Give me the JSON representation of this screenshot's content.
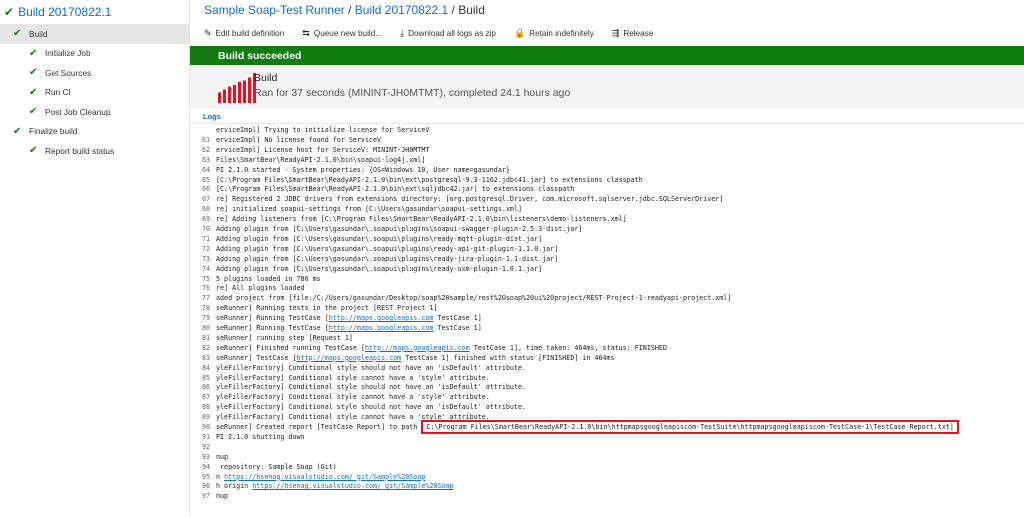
{
  "sidebar": {
    "build_title": "Build 20170822.1",
    "items": [
      {
        "label": "Build",
        "level": 0,
        "selected": true
      },
      {
        "label": "Initialize Job",
        "level": 1
      },
      {
        "label": "Get Sources",
        "level": 1
      },
      {
        "label": "Run CI",
        "level": 1
      },
      {
        "label": "Post Job Cleanup",
        "level": 1
      },
      {
        "label": "Finalize build",
        "level": 0
      },
      {
        "label": "Report build status",
        "level": 1
      }
    ]
  },
  "breadcrumb": {
    "runner": "Sample Soap-Test Runner",
    "sep1": " / ",
    "build": "Build 20170822.1",
    "sep2": " / ",
    "current": "Build"
  },
  "toolbar": {
    "items": [
      {
        "label": "Edit build definition",
        "icon": "pencil-icon",
        "glyph": "✎"
      },
      {
        "label": "Queue new build...",
        "icon": "queue-icon",
        "glyph": "⇆"
      },
      {
        "label": "Download all logs as zip",
        "icon": "download-icon",
        "glyph": "⤓"
      },
      {
        "label": "Retain indefinitely",
        "icon": "lock-icon",
        "glyph": "🔒"
      },
      {
        "label": "Release",
        "icon": "release-icon",
        "glyph": "⇶"
      }
    ]
  },
  "banner": {
    "text": "Build succeeded",
    "color": "#107c10"
  },
  "summary": {
    "name": "Build",
    "detail": "Ran for 37 seconds (MININT-JH0MTMT), completed 24.1 hours ago",
    "bar_levels": [
      0.35,
      0.45,
      0.55,
      0.6,
      0.7,
      0.75,
      0.85,
      1.0
    ],
    "bar_color": "#e81123"
  },
  "logs": {
    "label": "Logs",
    "lines": [
      {
        "n": "",
        "text": "erviceImpl] Trying to initialize license for ServiceV"
      },
      {
        "n": "61",
        "text": "erviceImpl] No license found for ServiceV"
      },
      {
        "n": "62",
        "text": "erviceImpl] License host for ServiceV: MININT-JH0MTMT"
      },
      {
        "n": "63",
        "text": "Files\\SmartBear\\ReadyAPI-2.1.0\\bin\\soapui-log4j.xml]"
      },
      {
        "n": "64",
        "text": "PI 2.1.0 started - System properties: {OS=Windows 10, User name=gasundar}"
      },
      {
        "n": "65",
        "text": "[C:\\Program Files\\SmartBear\\ReadyAPI-2.1.0\\bin\\ext\\postgresql-9.3-1102.jdbc41.jar] to extensions classpath"
      },
      {
        "n": "66",
        "text": "[C:\\Program Files\\SmartBear\\ReadyAPI-2.1.0\\bin\\ext\\sqljdbc42.jar] to extensions classpath"
      },
      {
        "n": "67",
        "text": "re] Registered 2 JDBC drivers from extensions directory: [org.postgresql.Driver, com.microsoft.sqlserver.jdbc.SQLServerDriver]"
      },
      {
        "n": "68",
        "text": "re] initialized soapui-settings from [C:\\Users\\gasundar\\soapui-settings.xml]"
      },
      {
        "n": "69",
        "text": "re] Adding listeners from [C:\\Program Files\\SmartBear\\ReadyAPI-2.1.0\\bin\\listeners\\demo-listeners.xml]"
      },
      {
        "n": "70",
        "text": "Adding plugin from [C:\\Users\\gasundar\\.soapui\\plugins\\soapui-swagger-plugin-2.5.3-dist.jar]"
      },
      {
        "n": "71",
        "text": "Adding plugin from [C:\\Users\\gasundar\\.soapui\\plugins\\ready-mqtt-plugin-dist.jar]"
      },
      {
        "n": "72",
        "text": "Adding plugin from [C:\\Users\\gasundar\\.soapui\\plugins\\ready-api-git-plugin-1.1.0.jar]"
      },
      {
        "n": "73",
        "text": "Adding plugin from [C:\\Users\\gasundar\\.soapui\\plugins\\ready-jira-plugin-1.1-dist.jar]"
      },
      {
        "n": "74",
        "text": "Adding plugin from [C:\\Users\\gasundar\\.soapui\\plugins\\ready-uxm-plugin-1.0.1.jar]"
      },
      {
        "n": "75",
        "text": "5 plugins loaded in 786 ms"
      },
      {
        "n": "76",
        "text": "re] All plugins loaded"
      },
      {
        "n": "77",
        "text": "aded project from [file:/C:/Users/gasundar/Desktop/soap%20sample/rest%20soap%20ui%20project/REST-Project-1-readyapi-project.xml]"
      },
      {
        "n": "78",
        "text": "seRunner] Running tests in the project [REST Project 1]"
      },
      {
        "n": "79",
        "pre": "seRunner] Running TestCase [",
        "link": "http://maps.googleapis.com",
        "post": " TestCase 1]"
      },
      {
        "n": "80",
        "pre": "seRunner] Running TestCase [",
        "link": "http://maps.googleapis.com",
        "post": " TestCase 1]"
      },
      {
        "n": "81",
        "text": "seRunner] running step [Request 1]"
      },
      {
        "n": "82",
        "pre": "seRunner] Finished running TestCase [",
        "link": "http://maps.googleapis.com",
        "post": " TestCase 1], time taken: 464ms, status: FINISHED"
      },
      {
        "n": "83",
        "pre": "seRunner] TestCase [",
        "link": "http://maps.googleapis.com",
        "post": " TestCase 1] finished with status [FINISHED] in 464ms"
      },
      {
        "n": "84",
        "text": "yleFillerFactory] Conditional style should not have an 'isDefault' attribute."
      },
      {
        "n": "85",
        "text": "yleFillerFactory] Conditional style cannot have a 'style' attribute."
      },
      {
        "n": "86",
        "text": "yleFillerFactory] Conditional style should not have an 'isDefault' attribute."
      },
      {
        "n": "87",
        "text": "yleFillerFactory] Conditional style cannot have a 'style' attribute."
      },
      {
        "n": "88",
        "text": "yleFillerFactory] Conditional style should not have an 'isDefault' attribute."
      },
      {
        "n": "89",
        "text": "yleFillerFactory] Conditional style cannot have a 'style' attribute."
      },
      {
        "n": "90",
        "pre": "seRunner] Created report [TestCase Report] to path ",
        "hl": "C:\\Program Files\\SmartBear\\ReadyAPI-2.1.0\\bin\\httpmapsgoogleapiscom-TestSuite\\httpmapsgoogleapiscom-TestCase-1\\TestCase Report.txt]"
      },
      {
        "n": "91",
        "text": "PI 2.1.0 shutting down"
      },
      {
        "n": "92",
        "text": ""
      },
      {
        "n": "93",
        "text": "nup"
      },
      {
        "n": "94",
        "text": " repository: Sample Soap (Git)"
      },
      {
        "n": "95",
        "pre": "n ",
        "link": "https://hsenag.visualstudio.com/_git/Sample%20Soap",
        "post": ""
      },
      {
        "n": "96",
        "pre": "h origin ",
        "link": "https://hsenag.visualstudio.com/_git/Sample%20Soap",
        "post": ""
      },
      {
        "n": "97",
        "text": "nup"
      }
    ]
  }
}
